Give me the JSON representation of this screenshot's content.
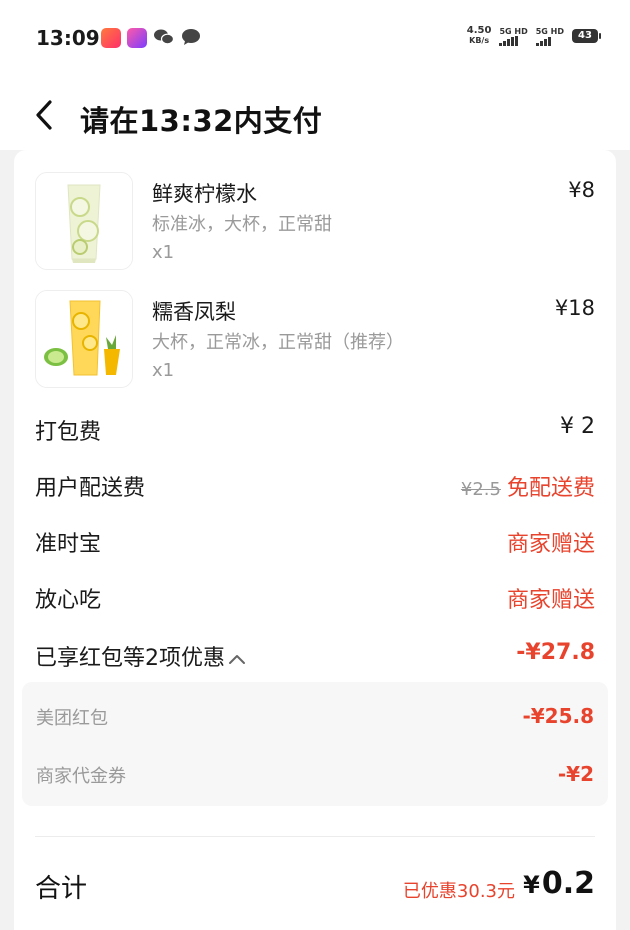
{
  "status_bar": {
    "time": "13:09",
    "net_speed_value": "4.50",
    "net_speed_unit": "KB/s",
    "signal1_label": "5G HD",
    "signal2_label": "5G HD",
    "battery": "43"
  },
  "header": {
    "title": "请在13:32内支付"
  },
  "items": [
    {
      "name": "鲜爽柠檬水",
      "spec": "标准冰，大杯，正常甜",
      "qty": "x1",
      "price": "¥8"
    },
    {
      "name": "糯香凤梨",
      "spec": "大杯，正常冰，正常甜（推荐）",
      "qty": "x1",
      "price": "¥18"
    }
  ],
  "fees": {
    "packing_label": "打包费",
    "packing_value": "¥ 2",
    "delivery_label": "用户配送费",
    "delivery_original": "¥2.5",
    "delivery_value": "免配送费",
    "ontime_label": "准时宝",
    "ontime_value": "商家赠送",
    "safe_label": "放心吃",
    "safe_value": "商家赠送"
  },
  "discounts": {
    "summary_label": "已享红包等2项优惠",
    "summary_value": "-¥27.8",
    "redpack_label": "美团红包",
    "redpack_value": "-¥25.8",
    "voucher_label": "商家代金券",
    "voucher_value": "-¥2"
  },
  "total": {
    "label": "合计",
    "saved": "已优惠30.3元",
    "currency": "¥",
    "amount": "0.2"
  },
  "colors": {
    "accent_red": "#e8432d",
    "muted_text": "#9a9a9a",
    "background": "#f2f2f2"
  },
  "icons": {
    "back": "chevron-left-icon",
    "expand": "chevron-up-icon"
  }
}
